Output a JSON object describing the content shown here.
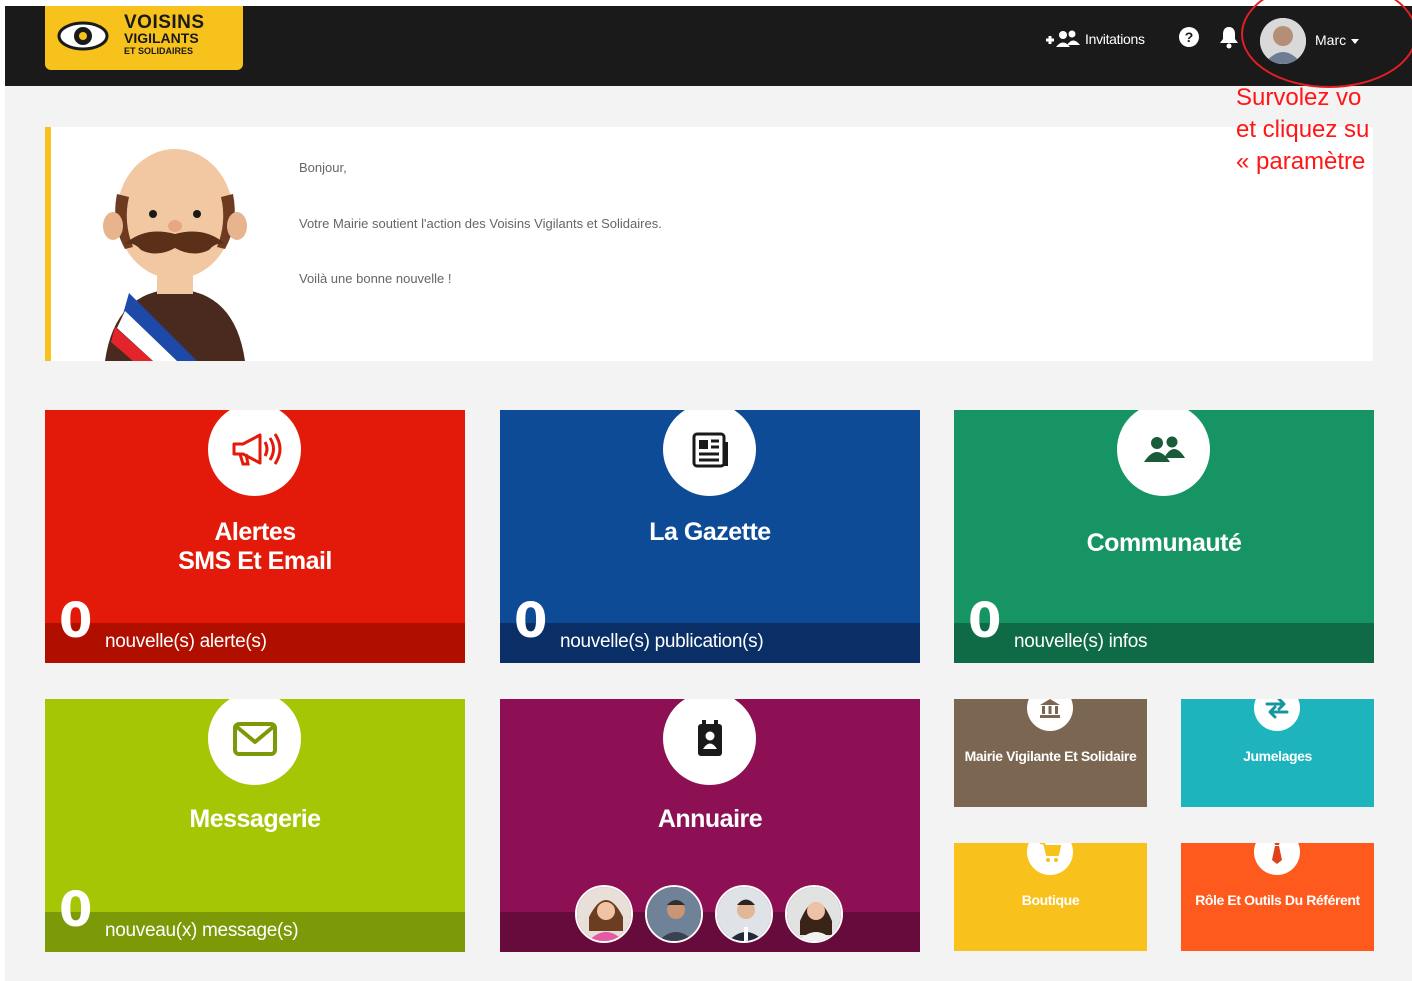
{
  "header": {
    "logo": {
      "line1": "VOISINS",
      "line2": "VIGILANTS",
      "line3": "ET SOLIDAIRES"
    },
    "invitations_label": "Invitations",
    "help_label": "?",
    "user_name": "Marc"
  },
  "callout": {
    "line1": "Survolez vo",
    "line2": "et cliquez su",
    "line3": "« paramètre",
    "color": "#ff1616"
  },
  "welcome": {
    "line1": "Bonjour,",
    "line2": "Votre Mairie soutient l'action des Voisins Vigilants et Solidaires.",
    "line3": "Voilà une bonne nouvelle !"
  },
  "tiles": {
    "alertes": {
      "title1": "Alertes",
      "title2": "SMS Et Email",
      "count": "0",
      "label": "nouvelle(s) alerte(s)",
      "color": "#e31a09",
      "icon": "megaphone-icon"
    },
    "gazette": {
      "title": "La Gazette",
      "count": "0",
      "label": "nouvelle(s) publication(s)",
      "color": "#0e4b96",
      "icon": "newspaper-icon"
    },
    "communaute": {
      "title": "Communauté",
      "count": "0",
      "label": "nouvelle(s) infos",
      "color": "#169463",
      "icon": "users-icon"
    },
    "messagerie": {
      "title": "Messagerie",
      "count": "0",
      "label": "nouveau(x) message(s)",
      "color": "#a5c605",
      "icon": "envelope-icon"
    },
    "annuaire": {
      "title": "Annuaire",
      "color": "#8c1053",
      "icon": "address-book-icon"
    },
    "mairie": {
      "title": "Mairie Vigilante Et Solidaire",
      "color": "#7b6651",
      "icon": "bank-icon"
    },
    "jumelages": {
      "title": "Jumelages",
      "color": "#1db4be",
      "icon": "exchange-icon"
    },
    "boutique": {
      "title": "Boutique",
      "color": "#f9c11c",
      "icon": "cart-icon"
    },
    "referent": {
      "title": "Rôle Et Outils Du Référent",
      "color": "#ff5a1e",
      "icon": "tie-icon"
    }
  }
}
